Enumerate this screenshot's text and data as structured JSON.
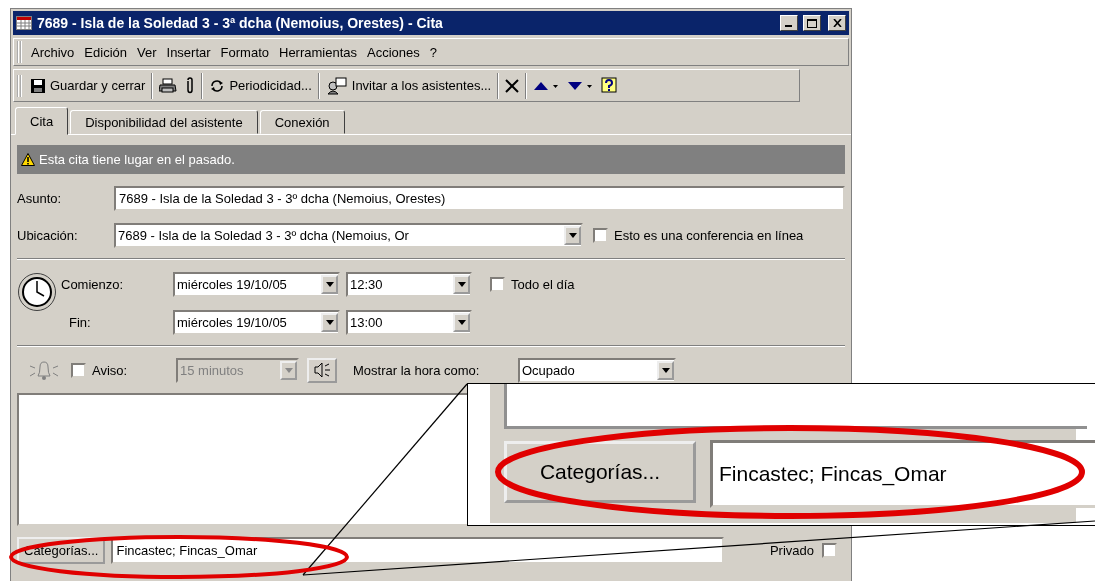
{
  "window": {
    "title": "7689 - Isla de la Soledad 3 - 3ª dcha (Nemoius, Orestes) - Cita"
  },
  "menu": [
    "Archivo",
    "Edición",
    "Ver",
    "Insertar",
    "Formato",
    "Herramientas",
    "Acciones",
    "?"
  ],
  "toolbar": [
    {
      "kind": "save",
      "label": "Guardar y cerrar"
    },
    {
      "kind": "separator"
    },
    {
      "kind": "print"
    },
    {
      "kind": "attach"
    },
    {
      "kind": "separator"
    },
    {
      "kind": "recurrence",
      "label": "Periodicidad..."
    },
    {
      "kind": "separator"
    },
    {
      "kind": "invite",
      "label": "Invitar a los asistentes..."
    },
    {
      "kind": "separator"
    },
    {
      "kind": "delete"
    },
    {
      "kind": "separator"
    },
    {
      "kind": "up"
    },
    {
      "kind": "down"
    },
    {
      "kind": "help"
    }
  ],
  "tabs": [
    {
      "label": "Cita",
      "selected": true
    },
    {
      "label": "Disponibilidad del asistente",
      "selected": false
    },
    {
      "label": "Conexión",
      "selected": false
    }
  ],
  "info_bar": {
    "text": "Esta cita tiene lugar en el pasado."
  },
  "subject": {
    "label": "Asunto:",
    "value": "7689 - Isla de la Soledad 3 - 3º dcha (Nemoius, Orestes)"
  },
  "location": {
    "label": "Ubicación:",
    "value": "7689 - Isla de la Soledad 3 - 3º dcha (Nemoius, Or"
  },
  "online_meeting": {
    "label": "Esto es una conferencia en línea",
    "checked": false
  },
  "start": {
    "label": "Comienzo:",
    "date": "miércoles 19/10/05",
    "time": "12:30"
  },
  "end": {
    "label": "Fin:",
    "date": "miércoles 19/10/05",
    "time": "13:00"
  },
  "all_day": {
    "label": "Todo el día",
    "checked": false
  },
  "reminder": {
    "label": "Aviso:",
    "checked": false,
    "value": "15 minutos",
    "disabled": true
  },
  "show_time_as": {
    "label": "Mostrar la hora como:",
    "value": "Ocupado"
  },
  "categories": {
    "button": "Categorías...",
    "value": "Fincastec; Fincas_Omar"
  },
  "private": {
    "label": "Privado",
    "checked": false
  },
  "callout": {
    "button": "Categorías...",
    "value": "Fincastec; Fincas_Omar"
  }
}
